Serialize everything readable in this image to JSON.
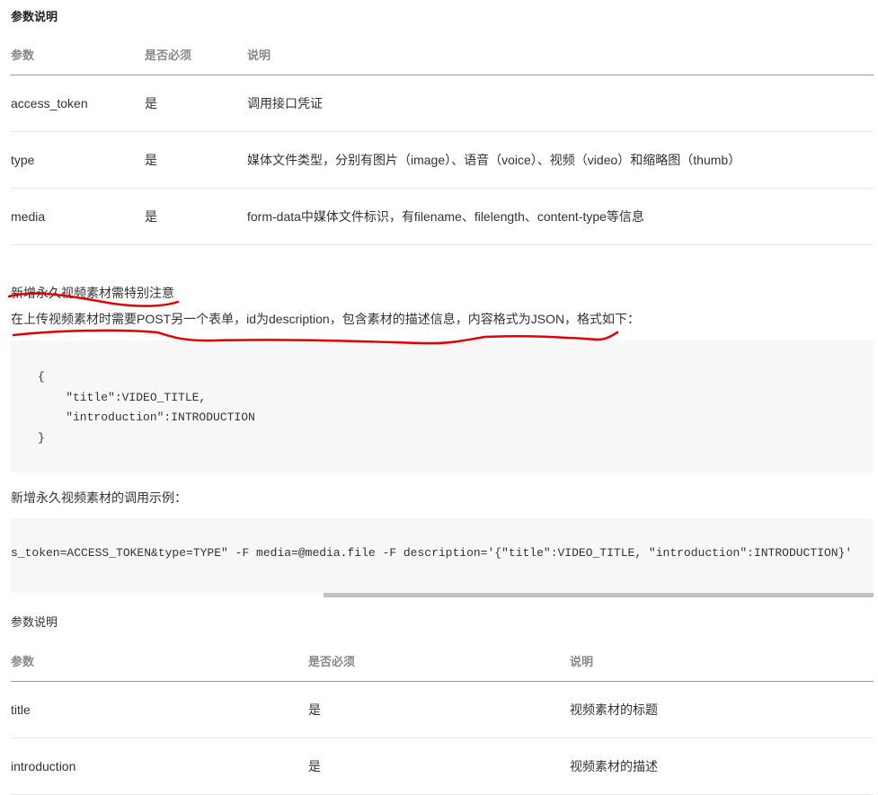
{
  "section1": {
    "title": "参数说明",
    "headers": [
      "参数",
      "是否必须",
      "说明"
    ],
    "rows": [
      [
        "access_token",
        "是",
        "调用接口凭证"
      ],
      [
        "type",
        "是",
        "媒体文件类型，分别有图片（image）、语音（voice）、视频（video）和缩略图（thumb）"
      ],
      [
        "media",
        "是",
        "form-data中媒体文件标识，有filename、filelength、content-type等信息"
      ]
    ]
  },
  "note1": "新增永久视频素材需特别注意",
  "note2": "在上传视频素材时需要POST另一个表单，id为description，包含素材的描述信息，内容格式为JSON，格式如下：",
  "code1": "{\n    \"title\":VIDEO_TITLE,\n    \"introduction\":INTRODUCTION\n}",
  "note3": "新增永久视频素材的调用示例：",
  "code2": "s_token=ACCESS_TOKEN&type=TYPE\" -F media=@media.file -F  description='{\"title\":VIDEO_TITLE, \"introduction\":INTRODUCTION}'",
  "section2": {
    "title": "参数说明",
    "headers": [
      "参数",
      "是否必须",
      "说明"
    ],
    "rows": [
      [
        "title",
        "是",
        "视频素材的标题"
      ],
      [
        "introduction",
        "是",
        "视频素材的描述"
      ]
    ]
  },
  "colors": {
    "annotation": "#e00000",
    "code_bg": "#f7f7f7"
  }
}
